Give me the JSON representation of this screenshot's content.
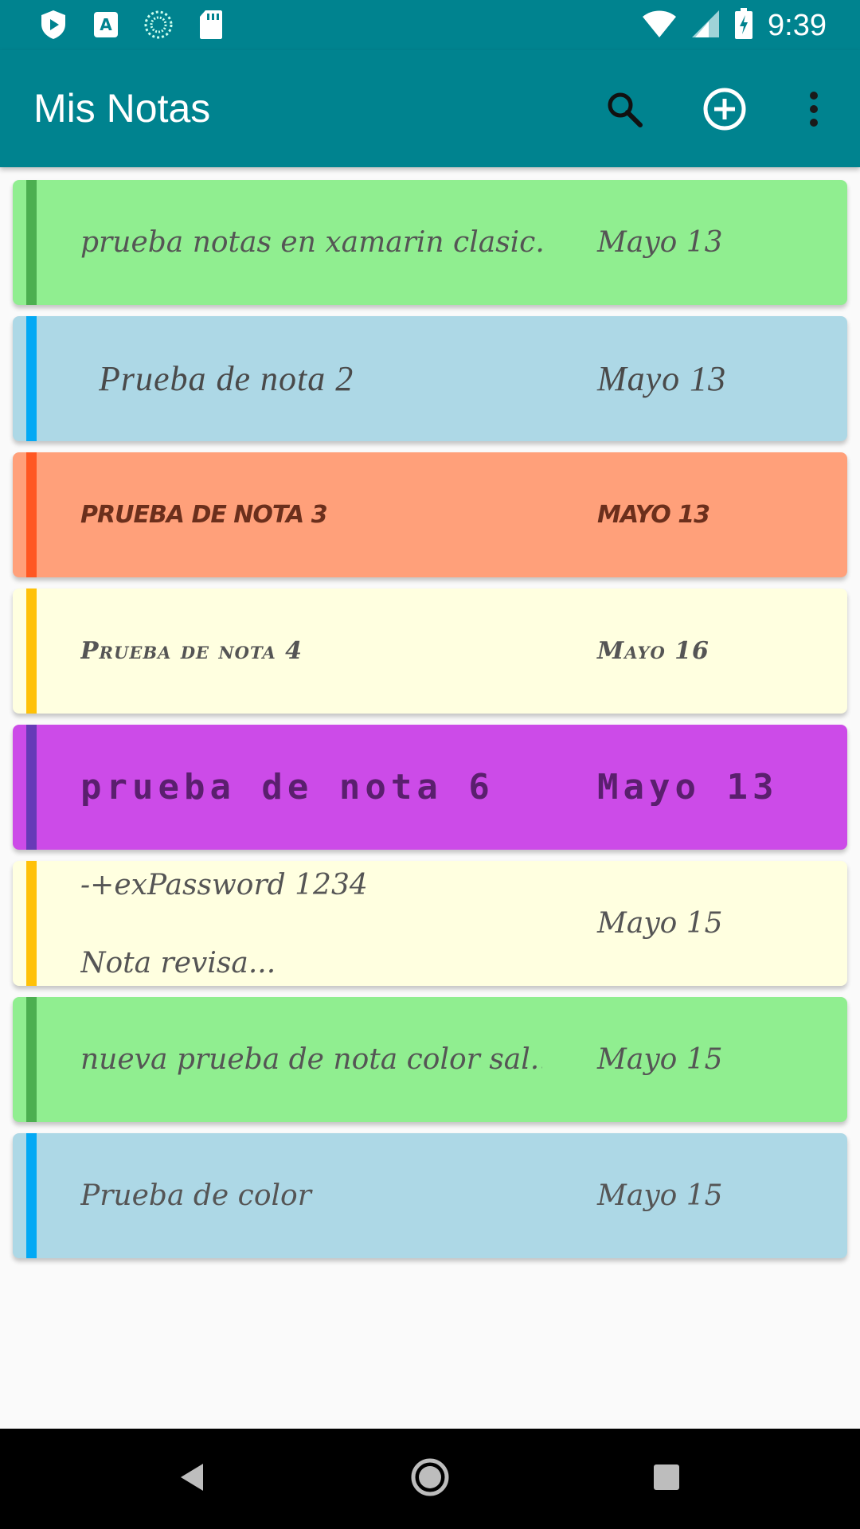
{
  "status_bar": {
    "time": "9:39",
    "icons": [
      "play-protect-icon",
      "accessibility-icon",
      "sync-icon",
      "sd-card-icon",
      "wifi-icon",
      "signal-icon",
      "battery-charging-icon"
    ]
  },
  "app_bar": {
    "title": "Mis Notas",
    "actions": [
      "search-icon",
      "add-circle-icon",
      "more-vert-icon"
    ],
    "color": "#00838F"
  },
  "notes": [
    {
      "title": "prueba notas en xamarin clasic...",
      "date": "Mayo 13",
      "background": "#90EE90",
      "stripe": "#4CAF50"
    },
    {
      "title": "Prueba de nota 2",
      "date": "Mayo 13",
      "background": "#ADD8E6",
      "stripe": "#03A9F4"
    },
    {
      "title": "PRUEBA DE NOTA 3",
      "date": "MAYO 13",
      "background": "#FFA07A",
      "stripe": "#FF5722"
    },
    {
      "title": "Prueba de nota 4",
      "date": "Mayo 16",
      "background": "#FFFFE0",
      "stripe": "#FFC107"
    },
    {
      "title": "prueba de nota 6",
      "date": "Mayo 13",
      "background": "#CC4BE8",
      "stripe": "#673AB7"
    },
    {
      "title_line1": "-+exPassword 1234",
      "title_line2": "Nota revisa...",
      "date": "Mayo 15",
      "background": "#FFFFE0",
      "stripe": "#FFC107"
    },
    {
      "title": "nueva prueba de nota color sal...",
      "date": "Mayo 15",
      "background": "#90EE90",
      "stripe": "#4CAF50"
    },
    {
      "title": "Prueba de color",
      "date": "Mayo 15",
      "background": "#ADD8E6",
      "stripe": "#03A9F4"
    }
  ],
  "nav_bar": {
    "buttons": [
      "back-icon",
      "home-icon",
      "recents-icon"
    ]
  }
}
